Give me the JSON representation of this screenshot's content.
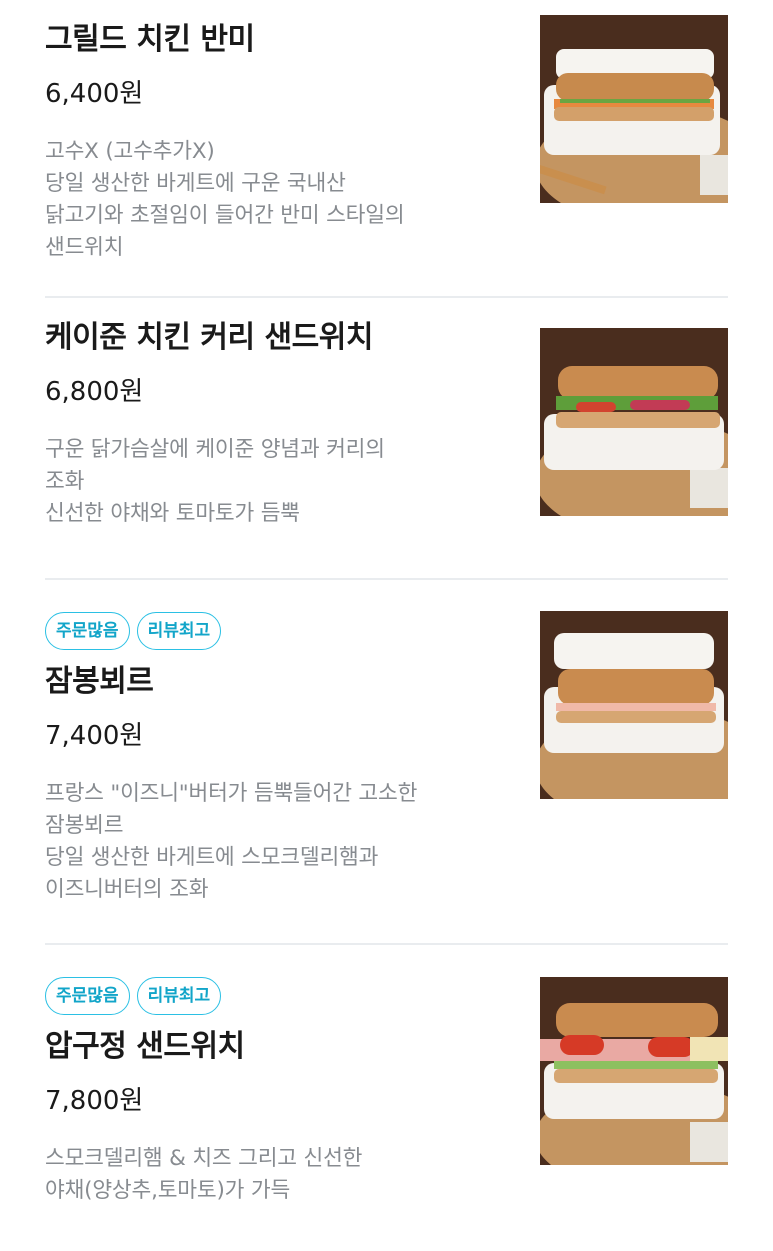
{
  "menu": {
    "items": [
      {
        "name": "그릴드 치킨 반미",
        "price": "6,400원",
        "badges": [],
        "description": "고수X (고수추가X)\n당일 생산한 바게트에 구운 국내산\n닭고기와 초절임이 들어간 반미 스타일의\n샌드위치"
      },
      {
        "name": "케이준 치킨 커리 샌드위치",
        "price": "6,800원",
        "badges": [],
        "description": "구운 닭가슴살에 케이준 양념과 커리의\n조화\n신선한 야채와 토마토가 듬뿍"
      },
      {
        "name": "잠봉뵈르",
        "price": "7,400원",
        "badges": [
          "주문많음",
          "리뷰최고"
        ],
        "description": "프랑스 \"이즈니\"버터가 듬뿍들어간 고소한\n잠봉뵈르\n당일 생산한 바게트에 스모크델리햄과\n이즈니버터의 조화"
      },
      {
        "name": "압구정 샌드위치",
        "price": "7,800원",
        "badges": [
          "주문많음",
          "리뷰최고"
        ],
        "description": "스모크델리햄 & 치즈 그리고 신선한\n야채(양상추,토마토)가 가득"
      }
    ]
  },
  "colors": {
    "badge_border": "#2bc0e4",
    "badge_text": "#12a5c9",
    "description": "#878b90",
    "divider": "#e9ecef"
  }
}
